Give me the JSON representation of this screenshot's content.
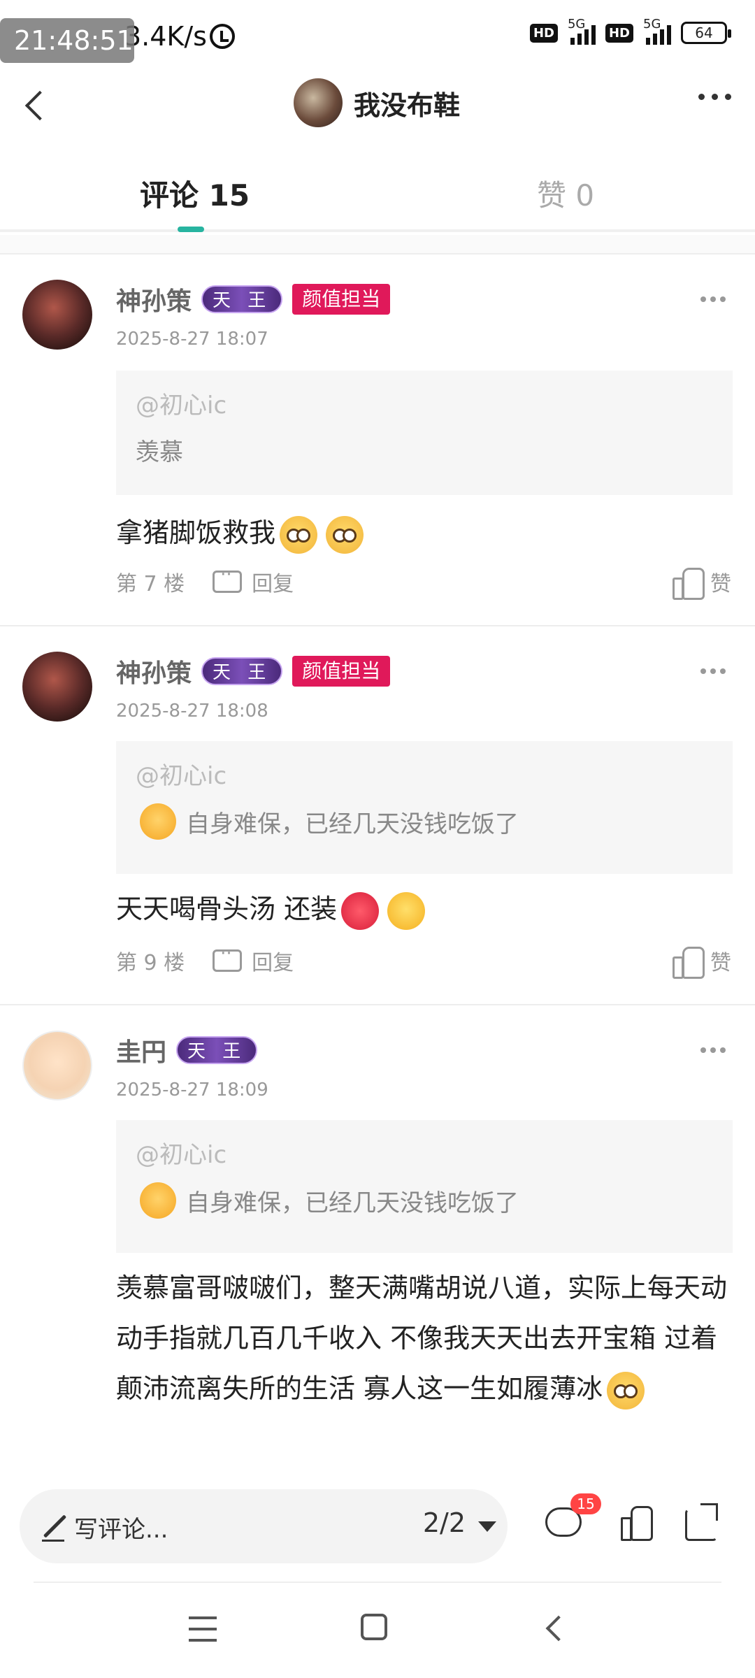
{
  "status_bar": {
    "time": "21:48:51",
    "net_speed": "3.4K/s",
    "hd1": "HD",
    "net1": "5G",
    "hd2": "HD",
    "net2": "5G",
    "battery": "64"
  },
  "header": {
    "title": "我没布鞋"
  },
  "tabs": [
    {
      "label": "评论 15",
      "active": true
    },
    {
      "label": "赞 0",
      "active": false
    }
  ],
  "comments": [
    {
      "name": "神孙策",
      "badge_level": "天 王",
      "badge_tag": "颜值担当",
      "time": "2025-8-27 18:07",
      "quote_at": "@初心ic",
      "quote_text": "羡慕",
      "body": "拿猪脚饭救我",
      "floor": "第 7 楼",
      "reply_label": "回复",
      "like_label": "赞"
    },
    {
      "name": "神孙策",
      "badge_level": "天 王",
      "badge_tag": "颜值担当",
      "time": "2025-8-27 18:08",
      "quote_at": "@初心ic",
      "quote_text": "自身难保，已经几天没钱吃饭了",
      "body": "天天喝骨头汤 还装",
      "floor": "第 9 楼",
      "reply_label": "回复",
      "like_label": "赞"
    },
    {
      "name": "圭円",
      "badge_level": "天 王",
      "time": "2025-8-27 18:09",
      "quote_at": "@初心ic",
      "quote_text": "自身难保，已经几天没钱吃饭了",
      "body": "羡慕富哥啵啵们，整天满嘴胡说八道，实际上每天动动手指就几百几千收入 不像我天天出去开宝箱 过着颠沛流离失所的生活 寡人这一生如履薄冰"
    }
  ],
  "bottom_bar": {
    "input_placeholder": "写评论...",
    "page_indicator": "2/2",
    "comment_count": "15"
  }
}
